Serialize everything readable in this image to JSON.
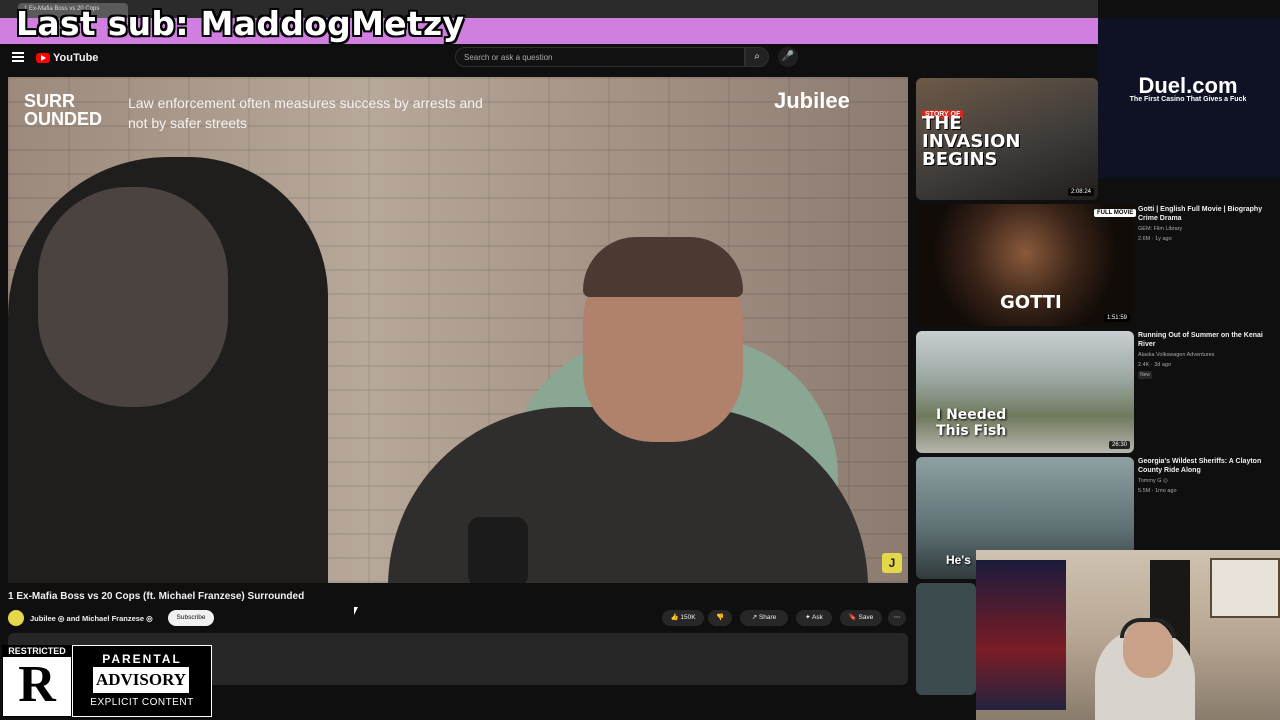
{
  "browser": {
    "tab_title": "1 Ex-Mafia Boss vs 20 Cops"
  },
  "overlay": {
    "last_sub": "Last sub: MaddogMetzy"
  },
  "masthead": {
    "logo": "YouTube",
    "search_placeholder": "Search or ask a question"
  },
  "player": {
    "brand": "SURR\nOUNDED",
    "caption": "Law enforcement often measures success by arrests and not by safer streets",
    "watermark": "Jubilee",
    "badge": "J"
  },
  "video": {
    "title": "1 Ex-Mafia Boss vs 20 Cops (ft. Michael Franzese) Surrounded",
    "channel": "Jubilee ◎ and Michael Franzese ◎",
    "subscribe": "Subscribe",
    "likes": "150K",
    "share": "Share",
    "ask": "Ask",
    "save": "Save"
  },
  "advisory": {
    "restricted_label": "RESTRICTED",
    "restricted_letter": "R",
    "line1": "PARENTAL",
    "line2": "ADVISORY",
    "line3": "EXPLICIT CONTENT"
  },
  "sidebar": [
    {
      "thumb_text": "THE INVASION BEGINS",
      "thumb_tag": "STORY OF",
      "duration": "2:08:24"
    },
    {
      "title": "Gotti | English Full Movie | Biography Crime Drama",
      "channel": "GEM: Film Library",
      "meta": "2.6M · 1y ago",
      "thumb_text": "GOTTI",
      "thumb_tag": "FULL MOVIE",
      "duration": "1:51:59"
    },
    {
      "title": "Running Out of Summer on the Kenai River",
      "channel": "Alaska Volkswagen Adventures",
      "meta": "2.4K · 3d ago",
      "badge": "New",
      "thumb_text": "I Needed\nThis Fish",
      "duration": "26:30"
    },
    {
      "title": "Georgia's Wildest Sheriffs: A Clayton County Ride Along",
      "channel": "Tommy G ◎",
      "meta": "5.5M · 1mo ago",
      "thumb_text": "He's"
    }
  ],
  "ad": {
    "logo": "Duel.com",
    "tagline": "The First Casino That Gives a Fuck"
  },
  "colors": {
    "yt_red": "#ff0000",
    "banner": "#d07ee0",
    "bg": "#0f0f0f"
  }
}
